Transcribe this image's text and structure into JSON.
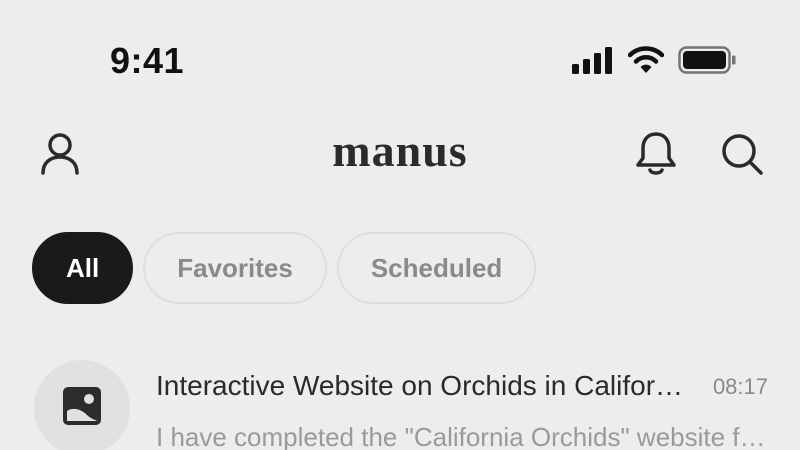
{
  "status_bar": {
    "time": "9:41",
    "icons": [
      "signal-icon",
      "wifi-icon",
      "battery-icon"
    ]
  },
  "header": {
    "logo": "manus",
    "left_icon": "user-icon",
    "right_icons": [
      "bell-icon",
      "search-icon"
    ]
  },
  "tabs": [
    {
      "label": "All",
      "active": true
    },
    {
      "label": "Favorites",
      "active": false
    },
    {
      "label": "Scheduled",
      "active": false
    }
  ],
  "tasks": [
    {
      "icon": "image-icon",
      "title": "Interactive Website on Orchids in California",
      "time": "08:17",
      "preview": "I have completed the \"California Orchids\" website for you"
    }
  ],
  "colors": {
    "background": "#ededed",
    "active_tab": "#1a1a1a",
    "muted_text": "#8a8a8a"
  }
}
